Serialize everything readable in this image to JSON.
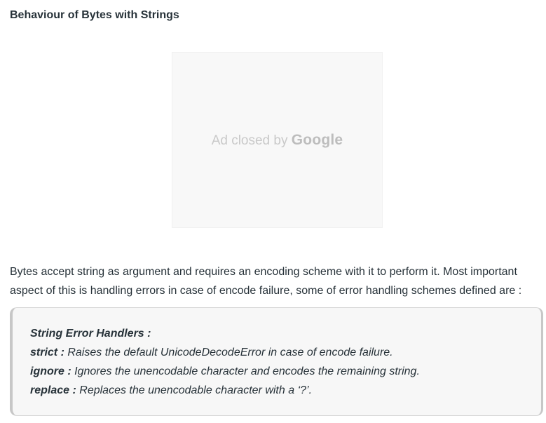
{
  "section": {
    "title": "Behaviour of Bytes with Strings"
  },
  "ad": {
    "text": "Ad closed by",
    "brand": "Google"
  },
  "paragraph": {
    "text": "Bytes accept string as argument and requires an encoding scheme with it to perform it. Most important aspect of this is handling errors in case of encode failure, some of error handling schemes defined are :"
  },
  "callout": {
    "heading": "String Error Handlers :",
    "items": [
      {
        "term": "strict :",
        "description": " Raises the default UnicodeDecodeError in case of encode failure."
      },
      {
        "term": "ignore :",
        "description": " Ignores the unencodable character and encodes the remaining string."
      },
      {
        "term": "replace :",
        "description": " Replaces the unencodable character with a ‘?’."
      }
    ]
  }
}
